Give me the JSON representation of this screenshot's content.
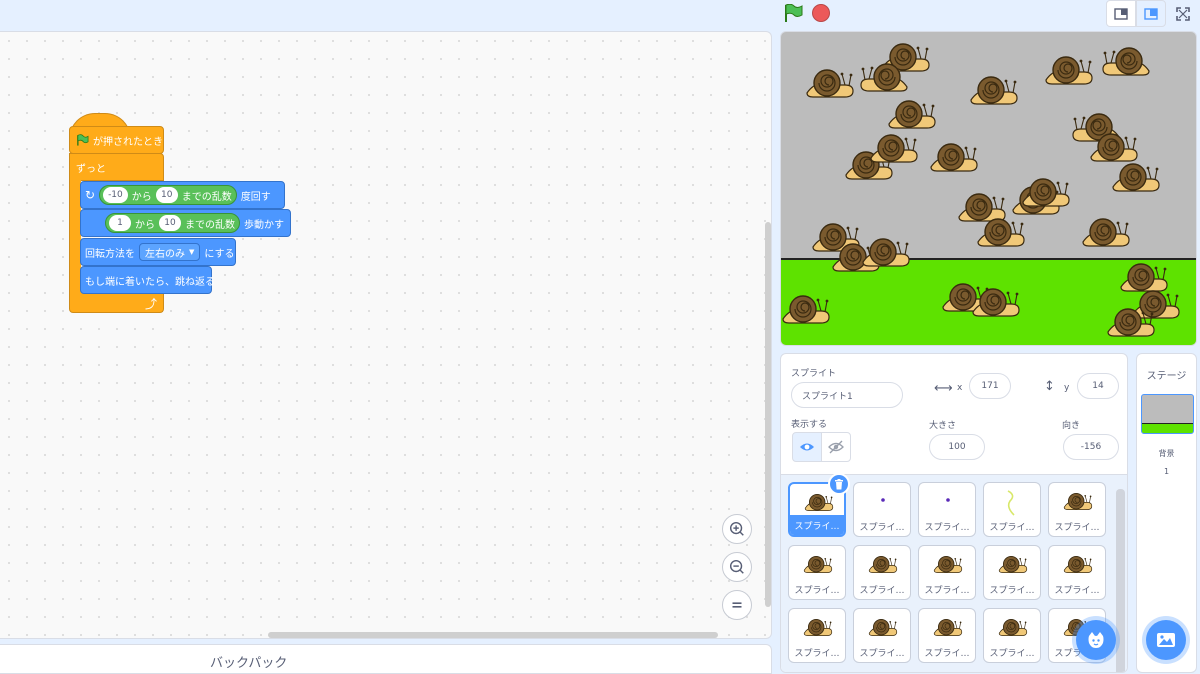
{
  "blocks": {
    "hat_label": "が押されたとき",
    "forever_label": "ずっと",
    "turn": {
      "min": "-10",
      "from": "から",
      "max": "10",
      "random": "までの乱数",
      "suffix": "度回す"
    },
    "move": {
      "min": "1",
      "from": "から",
      "max": "10",
      "random": "までの乱数",
      "suffix": "歩動かす"
    },
    "rotation": {
      "prefix": "回転方法を",
      "value": "左右のみ",
      "suffix": "にする"
    },
    "bounce": "もし端に着いたら、跳ね返る"
  },
  "backpack": "バックパック",
  "sprite_info": {
    "sprite_label": "スプライト",
    "name": "スプライト1",
    "x_label": "x",
    "x": "171",
    "y_label": "y",
    "y": "14",
    "show_label": "表示する",
    "size_label": "大きさ",
    "size": "100",
    "direction_label": "向き",
    "direction": "-156"
  },
  "sprites": [
    "スプライ…",
    "スプライ…",
    "スプライ…",
    "スプライ…",
    "スプライ…",
    "スプライ…",
    "スプライ…",
    "スプライ…",
    "スプライ…",
    "スプライ…",
    "スプライ…",
    "スプライ…",
    "スプライ…",
    "スプライ…",
    "スプライ…"
  ],
  "sprite_thumb_kinds": [
    "snail",
    "dot",
    "dot",
    "line",
    "snail",
    "snail",
    "snail",
    "snail",
    "snail",
    "snail",
    "snail",
    "snail",
    "snail",
    "snail",
    "snail"
  ],
  "stage_panel": {
    "title": "ステージ",
    "backdrop_label": "背景",
    "backdrop_count": "1"
  },
  "colors": {
    "motion": "#4c97ff",
    "control": "#ffab19",
    "operators": "#59c059",
    "events": "#ffab19",
    "ground": "#5ee200",
    "sky": "#bcbcbc"
  },
  "icons": [
    "green-flag-icon",
    "stop-icon",
    "small-stage-icon",
    "normal-stage-icon",
    "fullscreen-icon",
    "zoom-in-icon",
    "zoom-out-icon",
    "zoom-reset-icon",
    "eye-icon",
    "eye-hidden-icon",
    "trash-icon",
    "choose-sprite-icon",
    "choose-backdrop-icon"
  ]
}
